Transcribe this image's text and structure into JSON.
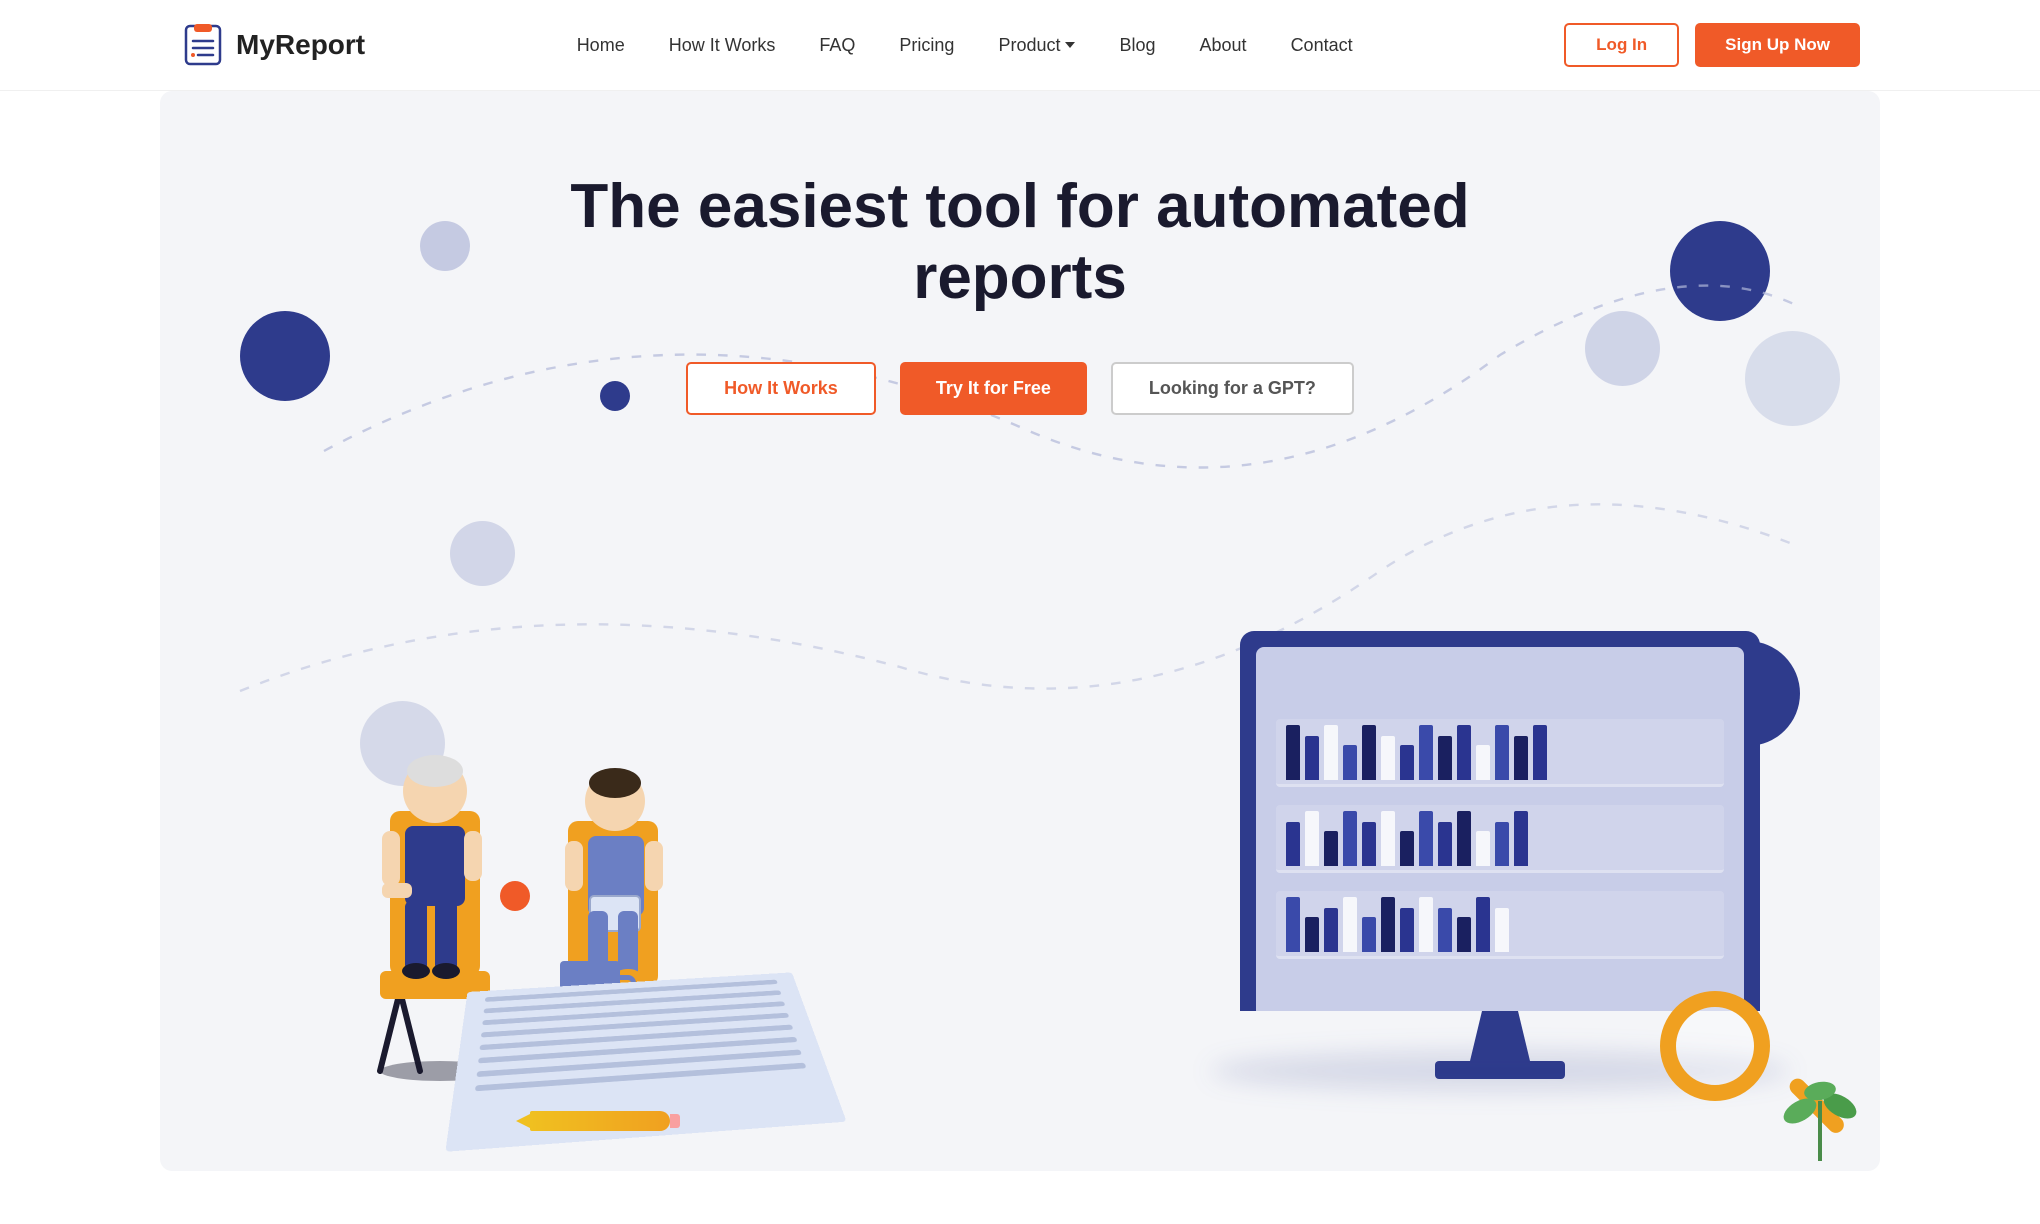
{
  "brand": {
    "logo_text": "MyReport",
    "logo_icon": "clipboard"
  },
  "nav": {
    "links": [
      {
        "id": "home",
        "label": "Home"
      },
      {
        "id": "how-it-works",
        "label": "How It Works"
      },
      {
        "id": "faq",
        "label": "FAQ"
      },
      {
        "id": "pricing",
        "label": "Pricing"
      },
      {
        "id": "product",
        "label": "Product"
      },
      {
        "id": "blog",
        "label": "Blog"
      },
      {
        "id": "about",
        "label": "About"
      },
      {
        "id": "contact",
        "label": "Contact"
      }
    ],
    "login_label": "Log In",
    "signup_label": "Sign Up Now"
  },
  "hero": {
    "title": "The easiest tool for automated reports",
    "button_how": "How It Works",
    "button_try": "Try It for Free",
    "button_gpt": "Looking for a GPT?"
  },
  "colors": {
    "primary_orange": "#f05a28",
    "primary_blue": "#2e3b8c",
    "light_blue": "#b0b8d8",
    "bg_hero": "#f4f5f8"
  }
}
